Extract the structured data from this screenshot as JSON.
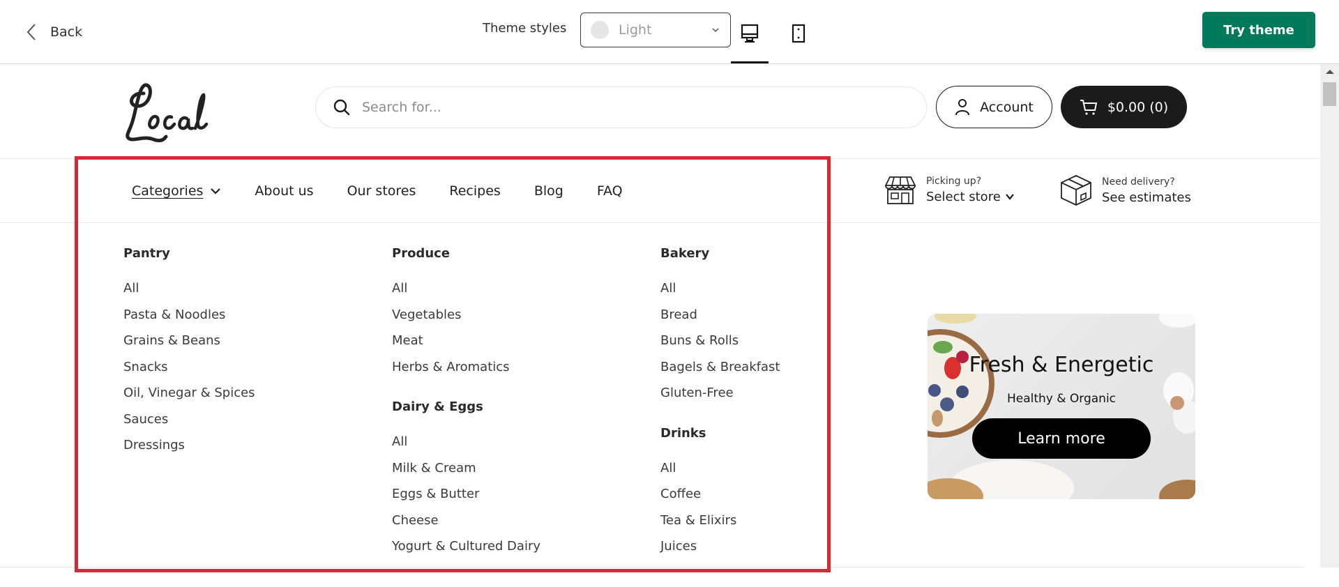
{
  "editor_bar": {
    "back_label": "Back",
    "theme_styles_label": "Theme styles",
    "theme_select_value": "Light",
    "try_theme_label": "Try theme",
    "active_device": "desktop",
    "accent_color": "#007a5a"
  },
  "header": {
    "logo_text": "Local",
    "search_placeholder": "Search for...",
    "account_label": "Account",
    "cart_label": "$0.00 (0)"
  },
  "nav": {
    "links": [
      {
        "label": "Categories",
        "active": true,
        "has_dropdown": true
      },
      {
        "label": "About us"
      },
      {
        "label": "Our stores"
      },
      {
        "label": "Recipes"
      },
      {
        "label": "Blog"
      },
      {
        "label": "FAQ"
      }
    ],
    "pickup": {
      "small": "Picking up?",
      "big": "Select store"
    },
    "delivery": {
      "small": "Need delivery?",
      "big": "See estimates"
    }
  },
  "mega_menu": {
    "columns": [
      {
        "groups": [
          {
            "title": "Pantry",
            "items": [
              "All",
              "Pasta & Noodles",
              "Grains & Beans",
              "Snacks",
              "Oil, Vinegar & Spices",
              "Sauces",
              "Dressings"
            ]
          }
        ]
      },
      {
        "groups": [
          {
            "title": "Produce",
            "items": [
              "All",
              "Vegetables",
              "Meat",
              "Herbs & Aromatics"
            ]
          },
          {
            "title": "Dairy & Eggs",
            "items": [
              "All",
              "Milk & Cream",
              "Eggs & Butter",
              "Cheese",
              "Yogurt & Cultured Dairy"
            ]
          }
        ]
      },
      {
        "groups": [
          {
            "title": "Bakery",
            "items": [
              "All",
              "Bread",
              "Buns & Rolls",
              "Bagels & Breakfast",
              "Gluten-Free"
            ]
          },
          {
            "title": "Drinks",
            "items": [
              "All",
              "Coffee",
              "Tea & Elixirs",
              "Juices"
            ]
          }
        ]
      }
    ],
    "banner": {
      "title": "Fresh & Energetic",
      "subtitle": "Healthy & Organic",
      "button_label": "Learn more"
    }
  },
  "highlight_color": "#d52a36"
}
